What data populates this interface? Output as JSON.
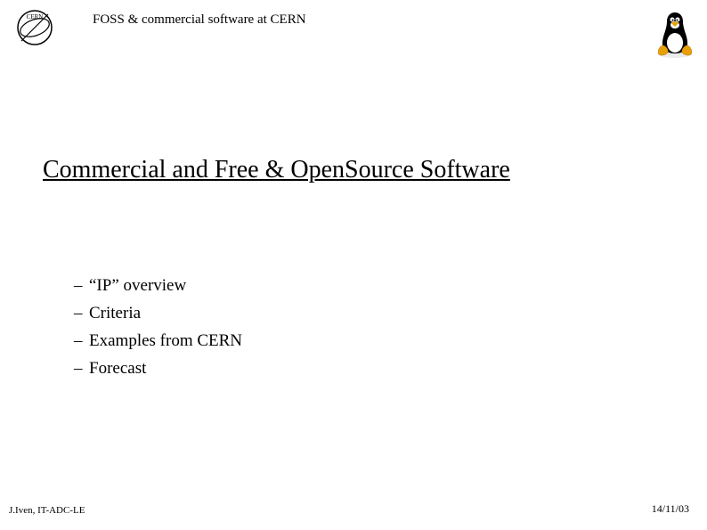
{
  "header": {
    "title": "FOSS & commercial software at CERN"
  },
  "slide": {
    "title": "Commercial and Free & OpenSource Software",
    "bullets": [
      "“IP” overview",
      "Criteria",
      "Examples from CERN",
      "Forecast"
    ]
  },
  "footer": {
    "author": "J.Iven, IT-ADC-LE",
    "date": "14/11/03"
  }
}
